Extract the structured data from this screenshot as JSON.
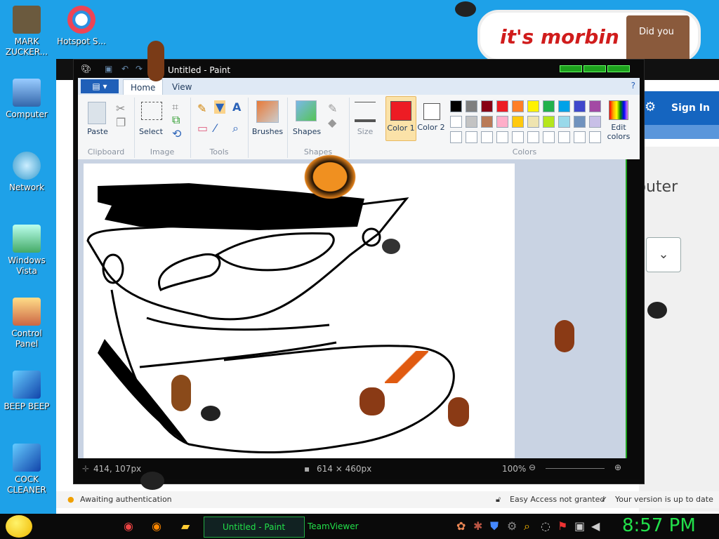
{
  "desktop": {
    "icons": [
      {
        "label": "MARK ZUCKER..."
      },
      {
        "label": "Hotspot S..."
      },
      {
        "label": "Computer"
      },
      {
        "label": "Network"
      },
      {
        "label": "Windows Vista"
      },
      {
        "label": "Control Panel"
      },
      {
        "label": "BEEP BEEP"
      },
      {
        "label": "COCK CLEANER"
      }
    ]
  },
  "meme": {
    "text": "it's morbin t",
    "caption": "Did you"
  },
  "background_app": {
    "signin": "Sign In",
    "partial_text": "puter",
    "status_left": "Awaiting authentication",
    "status_mid": "Easy Access not granted",
    "status_right": "Your version is up to date"
  },
  "paint": {
    "title": "Untitled - Paint",
    "tabs": {
      "file": "▤ ▾",
      "home": "Home",
      "view": "View"
    },
    "groups": {
      "clipboard": {
        "label": "Clipboard",
        "paste": "Paste"
      },
      "image": {
        "label": "Image",
        "select": "Select"
      },
      "tools": {
        "label": "Tools"
      },
      "brushes": {
        "label": "Brushes"
      },
      "shapes": {
        "label": "Shapes",
        "title": "Shapes"
      },
      "size": {
        "label": "Size"
      },
      "color1": {
        "label": "Color 1"
      },
      "color2": {
        "label": "Color 2"
      },
      "colors": {
        "label": "Colors"
      },
      "edit_colors": {
        "label": "Edit colors"
      }
    },
    "palette_row1": [
      "#000000",
      "#7f7f7f",
      "#880015",
      "#ed1c24",
      "#ff7f27",
      "#fff200",
      "#22b14c",
      "#00a2e8",
      "#3f48cc",
      "#a349a4"
    ],
    "palette_row2": [
      "#ffffff",
      "#c3c3c3",
      "#b97a57",
      "#ffaec9",
      "#ffc90e",
      "#efe4b0",
      "#b5e61d",
      "#99d9ea",
      "#7092be",
      "#c8bfe7"
    ],
    "color1_value": "#ed1c24",
    "color2_value": "#ffffff",
    "status": {
      "cursor": "414, 107px",
      "size": "614 × 460px",
      "zoom": "100%"
    }
  },
  "taskbar": {
    "tasks": [
      {
        "label": "Untitled - Paint"
      },
      {
        "label": "TeamViewer"
      }
    ],
    "clock": "8:57 PM"
  }
}
